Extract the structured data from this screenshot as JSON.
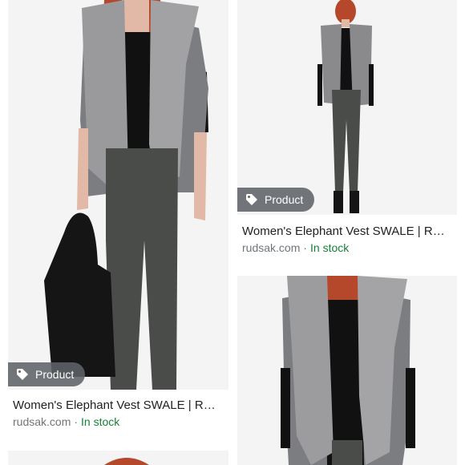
{
  "results": [
    {
      "badge": "Product",
      "title": "Women's Elephant Vest SWALE | RU...",
      "source": "rudsak.com",
      "separator": "·",
      "availability": "In stock"
    },
    {
      "badge": "Product",
      "title": "Women's Elephant Vest SWALE | RU...",
      "source": "rudsak.com",
      "separator": "·",
      "availability": "In stock"
    }
  ],
  "colors": {
    "badge_bg": "#5f6368",
    "title": "#202124",
    "source": "#70757a",
    "in_stock": "#188038",
    "image_bg": "#f3f3f3",
    "fur": "#8a8a8c",
    "knit": "#7b7d80",
    "leather": "#4a4c4a",
    "top": "#111111",
    "hair": "#b5482a",
    "skin": "#e2b9a6",
    "bag": "#151515"
  },
  "icons": [
    "tag-icon"
  ]
}
